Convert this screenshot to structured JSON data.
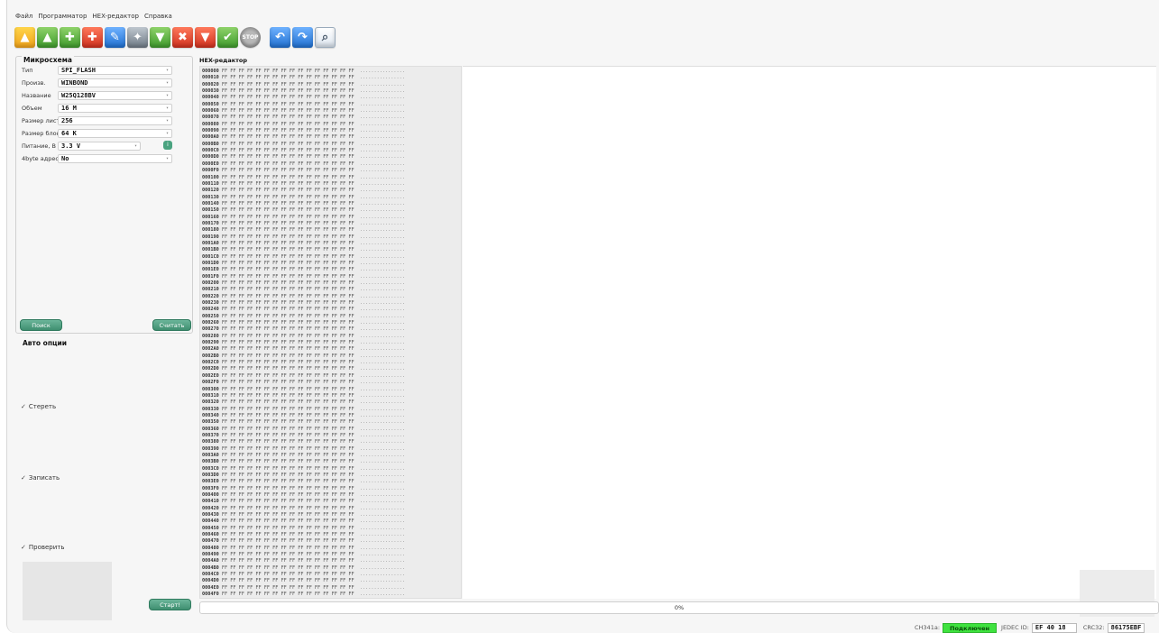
{
  "menu": [
    "Файл",
    "Программатор",
    "HEX-редактор",
    "Справка"
  ],
  "toolbar": {
    "buttons": [
      {
        "name": "open-file-icon",
        "glyph": "📂",
        "color": "#f0a21a"
      },
      {
        "name": "save-file-icon",
        "glyph": "⬆",
        "color": "#3e9a2c"
      },
      {
        "name": "read-chip-icon",
        "glyph": "✚",
        "color": "#3e9a2c"
      },
      {
        "name": "erase-chip-icon",
        "glyph": "✚",
        "color": "#d0301e"
      },
      {
        "name": "edit-chip-icon",
        "glyph": "✎",
        "color": "#1f6fd0"
      },
      {
        "name": "detect-chip-icon",
        "glyph": "✦",
        "color": "#6f7a85"
      },
      {
        "name": "write-chip-icon",
        "glyph": "⬇",
        "color": "#3e9a2c"
      },
      {
        "name": "blank-check-icon",
        "glyph": "✖",
        "color": "#d0301e"
      },
      {
        "name": "erase-icon",
        "glyph": "⬇",
        "color": "#d0301e"
      },
      {
        "name": "verify-icon",
        "glyph": "✔",
        "color": "#3e9a2c"
      },
      {
        "name": "stop-icon",
        "glyph": "STOP",
        "color": "#8a8a8a"
      },
      {
        "name": "undo-icon",
        "glyph": "↶",
        "color": "#1f6fd0"
      },
      {
        "name": "redo-icon",
        "glyph": "↷",
        "color": "#1f6fd0"
      },
      {
        "name": "search-icon",
        "glyph": "🔍",
        "color": "#ffffff"
      }
    ]
  },
  "chip": {
    "title": "Микросхема",
    "fields": [
      {
        "label": "Тип",
        "value": "SPI_FLASH"
      },
      {
        "label": "Произв.",
        "value": "WINBOND"
      },
      {
        "label": "Название",
        "value": "W25Q128BV"
      },
      {
        "label": "Объем",
        "value": "16 M"
      },
      {
        "label": "Размер листа",
        "value": "256"
      },
      {
        "label": "Размер блока",
        "value": "64 K"
      },
      {
        "label": "Питание, В",
        "value": "3.3 V"
      },
      {
        "label": "4byte адрес",
        "value": "No"
      }
    ],
    "search_label": "Поиск",
    "read_label": "Считать"
  },
  "auto": {
    "title": "Авто опции",
    "options": [
      {
        "label": "Стереть",
        "checked": true
      },
      {
        "label": "Записать",
        "checked": true
      },
      {
        "label": "Проверить",
        "checked": true
      }
    ],
    "start_label": "Старт!"
  },
  "hex": {
    "title": "HEX-редактор",
    "fill_byte": "FF",
    "bytes_per_row": 16,
    "start_address": 0,
    "row_count": 80,
    "ascii_placeholder": "................"
  },
  "progress": {
    "value": 0,
    "label": "0%"
  },
  "status": {
    "adapter_label": "CH341a:",
    "adapter_state": "Подключен",
    "adapter_state_color": "#3fe23f",
    "jedec_label": "JEDEC ID:",
    "jedec_value": "EF 40 18",
    "crc_label": "CRC32:",
    "crc_value": "86175EBF"
  }
}
